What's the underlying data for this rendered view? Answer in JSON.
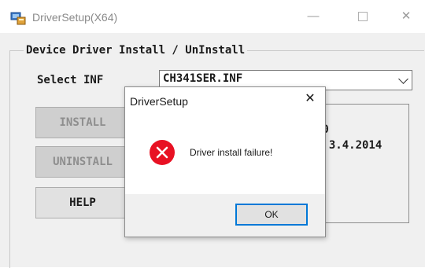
{
  "window": {
    "title": "DriverSetup(X64)",
    "controls": {
      "minimize": "—",
      "close": "✕"
    }
  },
  "group": {
    "legend": "Device Driver Install / UnInstall",
    "select_label": "Select INF",
    "inf_value": "CH341SER.INF",
    "buttons": {
      "install": "INSTALL",
      "uninstall": "UNINSTALL",
      "help": "HELP"
    },
    "info": {
      "line1": "40",
      "line2": ", 3.4.2014"
    }
  },
  "dialog": {
    "title": "DriverSetup",
    "close": "✕",
    "message": "Driver install failure!",
    "ok_label": "OK"
  },
  "colors": {
    "error_red": "#e81123",
    "focus_blue": "#0078d7"
  },
  "icons": {
    "app": "driver-setup-app-icon",
    "error": "error-circle-x-icon"
  }
}
